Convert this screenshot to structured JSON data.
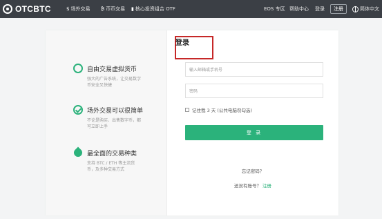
{
  "nav": {
    "logo": "OTCBTC",
    "items": [
      {
        "label": "场外交易",
        "icon": "dollar-icon"
      },
      {
        "label": "币币交易",
        "icon": "bitcoin-icon"
      },
      {
        "label": "核心投资组合 OTF",
        "icon": "bar-chart-icon"
      }
    ],
    "right": {
      "eos": "EOS 专区",
      "help": "帮助中心",
      "login": "登录",
      "register": "注册",
      "language": "简体中文"
    }
  },
  "features": [
    {
      "title": "自由交易虚拟货币",
      "desc": "强大的广告系统，让交易数字币安全又快捷",
      "icon": "dollar-cycle-icon"
    },
    {
      "title": "场外交易可以很简单",
      "desc": "不论是购买、出售数字币，都可立即上手",
      "icon": "check-circle-icon"
    },
    {
      "title": "最全面的交易种类",
      "desc": "支持 BTC / ETH 等主流货币，及多种交易方式",
      "icon": "drop-icon"
    }
  ],
  "login": {
    "title": "登录",
    "email_placeholder": "输入邮箱或手机号",
    "password_placeholder": "密码",
    "remember": "记住我 3 天 (公共电脑勿勾选)",
    "submit": "登 录",
    "forgot": "忘记密码？",
    "no_account": "还没有账号？",
    "register_link": "注册"
  },
  "colors": {
    "brand": "#2bb27b",
    "topbar": "#3b3f45",
    "highlight_border": "#c62828"
  }
}
